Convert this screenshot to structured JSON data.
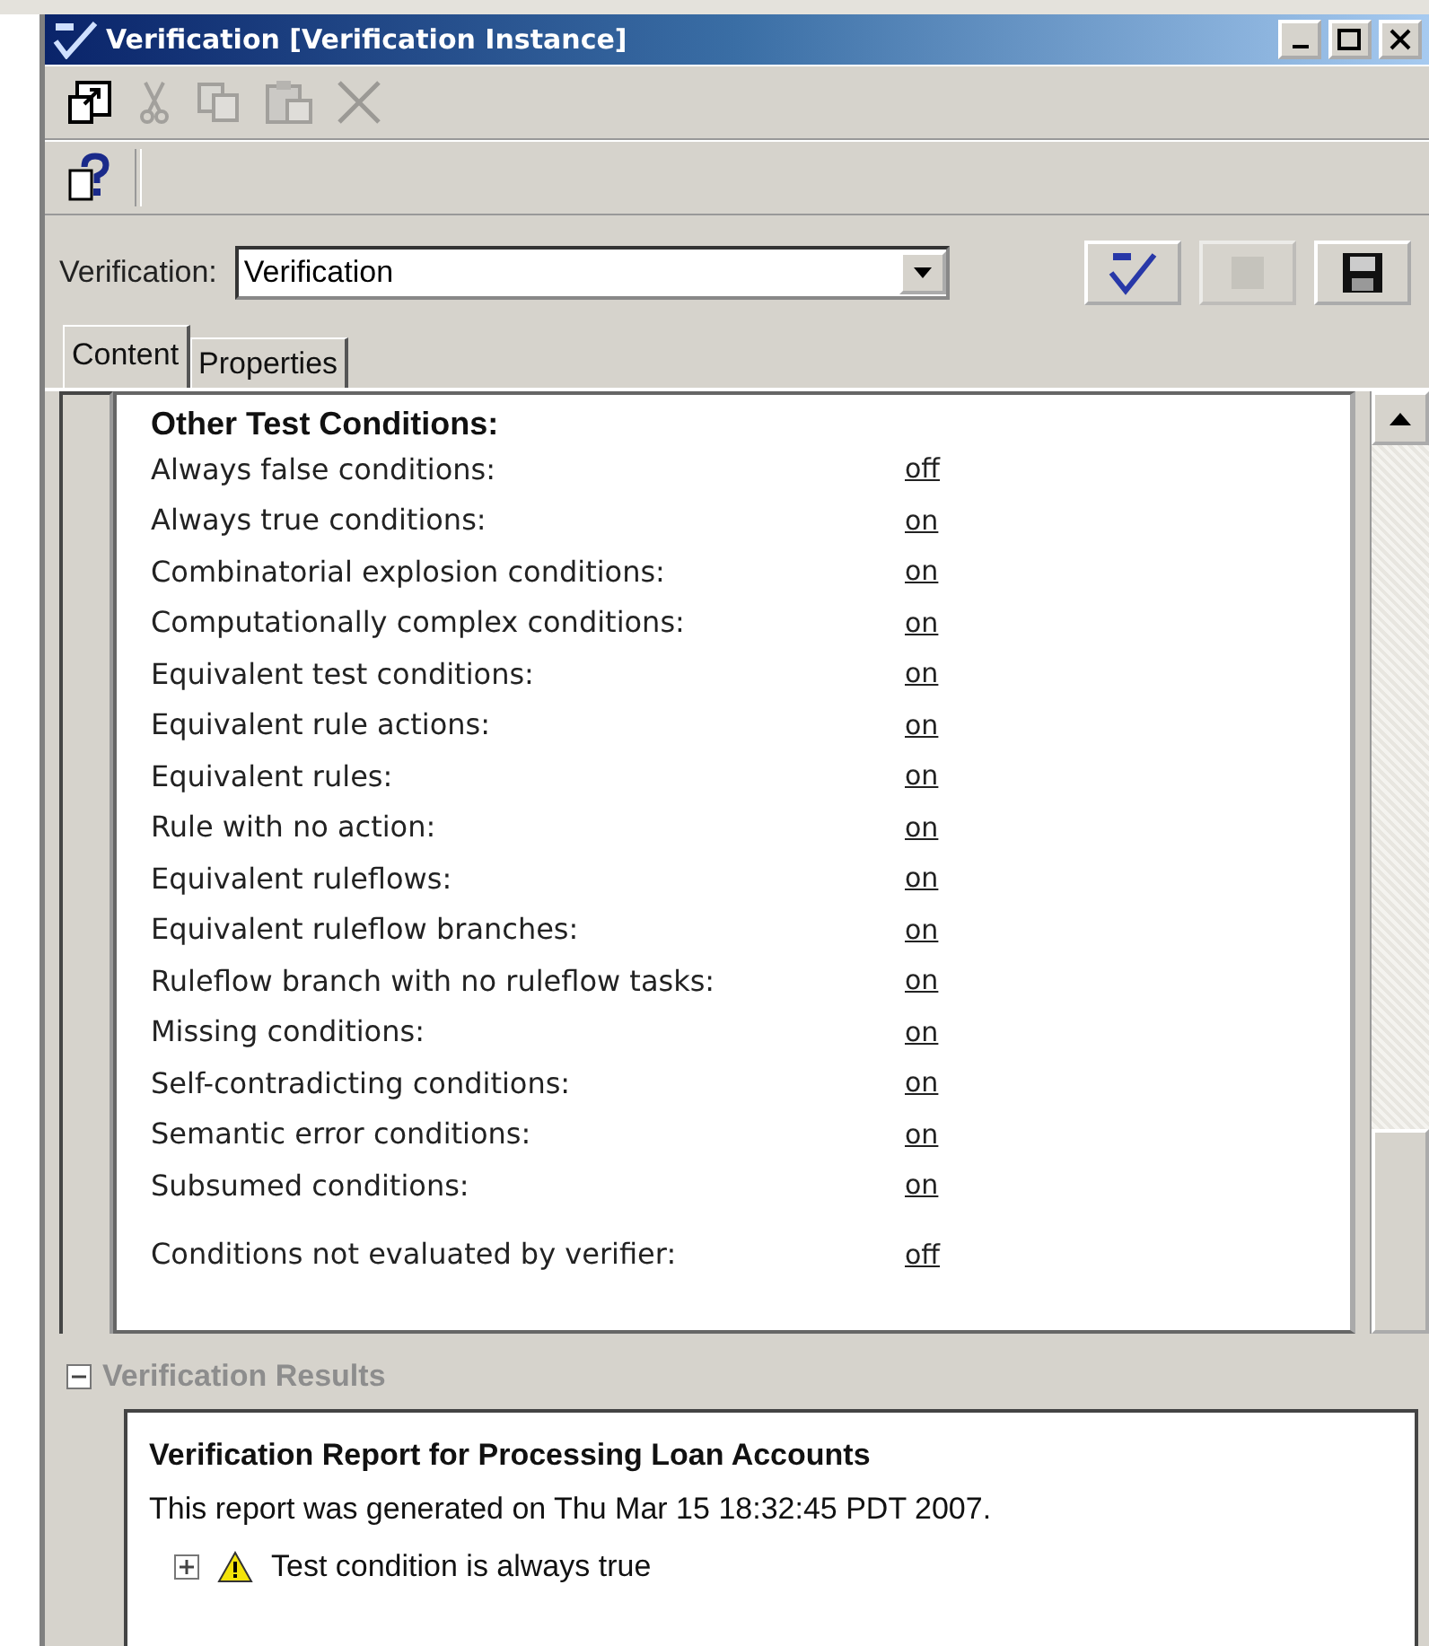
{
  "window": {
    "title": "Verification [Verification Instance]"
  },
  "toolbar": [
    {
      "kind": "window",
      "disabled": false
    },
    {
      "kind": "cut",
      "disabled": true
    },
    {
      "kind": "copy",
      "disabled": true
    },
    {
      "kind": "paste",
      "disabled": true
    },
    {
      "kind": "delete",
      "disabled": true
    }
  ],
  "verification": {
    "label": "Verification:",
    "value": "Verification"
  },
  "actions": [
    {
      "kind": "verify",
      "disabled": false
    },
    {
      "kind": "stop",
      "disabled": true
    },
    {
      "kind": "save",
      "disabled": false
    }
  ],
  "tabs": [
    {
      "label": "Content",
      "selected": true
    },
    {
      "label": "Properties",
      "selected": false
    }
  ],
  "conditions": {
    "heading": "Other Test Conditions:",
    "rows": [
      {
        "label": "Always false conditions:",
        "value": "off"
      },
      {
        "label": "Always true conditions:",
        "value": "on"
      },
      {
        "label": "Combinatorial explosion conditions:",
        "value": "on"
      },
      {
        "label": "Computationally complex conditions:",
        "value": "on"
      },
      {
        "label": "Equivalent test conditions:",
        "value": "on"
      },
      {
        "label": "Equivalent rule actions:",
        "value": "on"
      },
      {
        "label": "Equivalent rules:",
        "value": "on"
      },
      {
        "label": "Rule with no action:",
        "value": "on"
      },
      {
        "label": "Equivalent ruleflows:",
        "value": "on"
      },
      {
        "label": "Equivalent ruleflow branches:",
        "value": "on"
      },
      {
        "label": "Ruleflow branch with no ruleflow tasks:",
        "value": "on"
      },
      {
        "label": "Missing conditions:",
        "value": "on"
      },
      {
        "label": "Self-contradicting conditions:",
        "value": "on"
      },
      {
        "label": "Semantic error conditions:",
        "value": "on"
      },
      {
        "label": "Subsumed conditions:",
        "value": "on"
      }
    ],
    "last_row": {
      "label": "Conditions not evaluated by verifier:",
      "value": "off"
    }
  },
  "results": {
    "title": "Verification Results",
    "expanded": true,
    "report_title": "Verification Report for Processing Loan Accounts",
    "generated": "This report was generated on Thu Mar 15 18:32:45 PDT 2007.",
    "items": [
      {
        "text": "Test condition is always true",
        "expanded": false
      }
    ]
  }
}
